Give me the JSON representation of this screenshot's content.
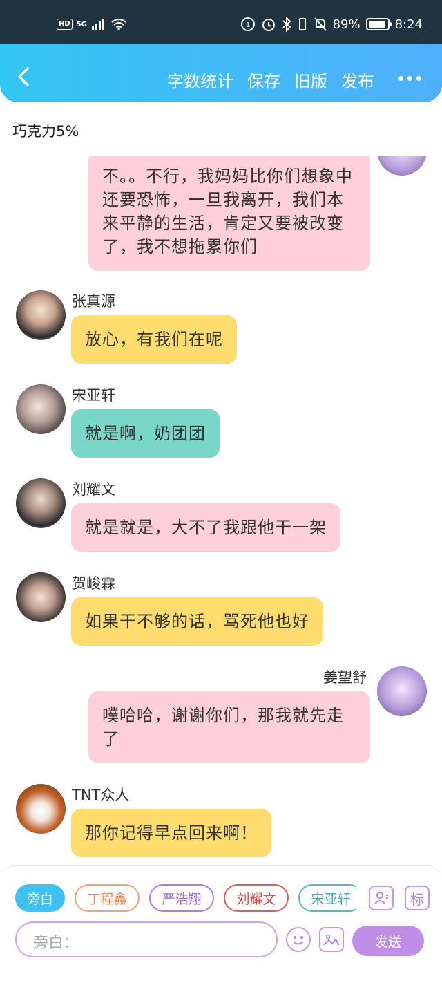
{
  "status_bar": {
    "hd": "HD",
    "network": "5G",
    "battery_text": "89%",
    "battery_level": 0.89,
    "time": "8:24"
  },
  "header": {
    "back_icon": "chevron-left-icon",
    "actions": [
      "字数统计",
      "保存",
      "旧版",
      "发布"
    ],
    "more_icon": "more-dots-icon"
  },
  "title": "巧克力5%",
  "messages": [
    {
      "side": "right",
      "sender": "",
      "text": "不。。不行，我妈妈比你们想象中还要恐怖，一旦我离开，我们本来平静的生活，肯定又要被改变了，我不想拖累你们",
      "color": "#ffcfdc"
    },
    {
      "side": "left",
      "sender": "张真源",
      "text": "放心，有我们在呢",
      "color": "#ffdc6e"
    },
    {
      "side": "left",
      "sender": "宋亚轩",
      "text": "就是啊，奶团团",
      "color": "#79d7c8"
    },
    {
      "side": "left",
      "sender": "刘耀文",
      "text": "就是就是，大不了我跟他干一架",
      "color": "#ffcfdc"
    },
    {
      "side": "left",
      "sender": "贺峻霖",
      "text": "如果干不够的话，骂死他也好",
      "color": "#ffdc6e"
    },
    {
      "side": "right",
      "sender": "姜望舒",
      "text": "噗哈哈，谢谢你们，那我就先走了",
      "color": "#ffcfdc"
    },
    {
      "side": "left",
      "sender": "TNT众人",
      "text": "那你记得早点回来啊！",
      "color": "#ffdc6e"
    }
  ],
  "bottom": {
    "chips": [
      "旁白",
      "丁程鑫",
      "严浩翔",
      "刘耀文",
      "宋亚轩"
    ],
    "role_icon": "person-card-icon",
    "tag_label": "标",
    "input_placeholder": "旁白：",
    "emoji_icon": "smiley-icon",
    "image_icon": "image-icon",
    "send_label": "发送"
  }
}
